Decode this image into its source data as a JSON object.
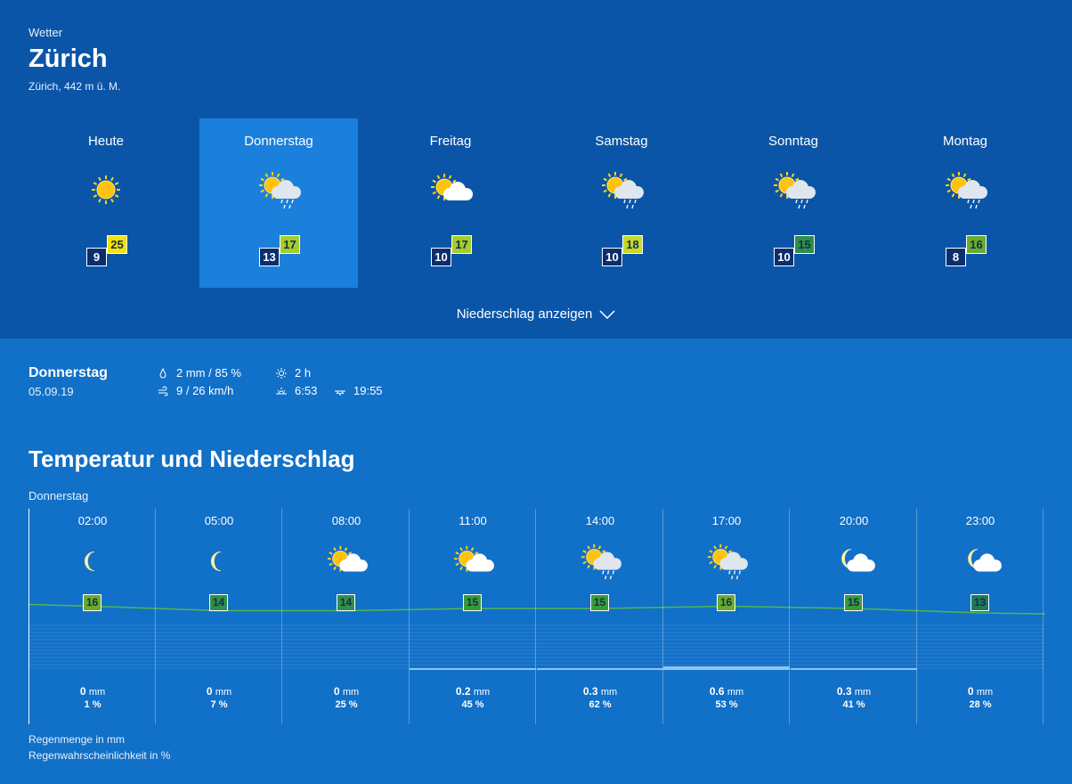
{
  "header": {
    "section_label": "Wetter",
    "city": "Zürich",
    "altitude": "Zürich, 442 m ü. M."
  },
  "days": [
    {
      "name": "Heute",
      "min": "9",
      "max": "25",
      "max_color": "#f5e20a",
      "icon": "sun-icon",
      "selected": false
    },
    {
      "name": "Donnerstag",
      "min": "13",
      "max": "17",
      "max_color": "#a8cc2a",
      "icon": "sun-cloud-rain-icon",
      "selected": true
    },
    {
      "name": "Freitag",
      "min": "10",
      "max": "17",
      "max_color": "#a8cc2a",
      "icon": "sun-cloud-icon",
      "selected": false
    },
    {
      "name": "Samstag",
      "min": "10",
      "max": "18",
      "max_color": "#c7d82a",
      "icon": "sun-cloud-rain-icon",
      "selected": false
    },
    {
      "name": "Sonntag",
      "min": "10",
      "max": "15",
      "max_color": "#2e8f4a",
      "icon": "sun-cloud-rain-icon",
      "selected": false
    },
    {
      "name": "Montag",
      "min": "8",
      "max": "16",
      "max_color": "#6aab2e",
      "icon": "sun-cloud-rain-icon",
      "selected": false
    }
  ],
  "toggle_label": "Niederschlag anzeigen",
  "detail": {
    "day": "Donnerstag",
    "date": "05.09.19",
    "rain": "2 mm / 85 %",
    "wind": "9 / 26 km/h",
    "sunshine": "2 h",
    "sunrise": "6:53",
    "sunset": "19:55"
  },
  "section_title": "Temperatur und Niederschlag",
  "sub_day": "Donnerstag",
  "hours": [
    {
      "time": "02:00",
      "temp": "16",
      "temp_color": "#6aab2e",
      "rain": "0",
      "unit": "mm",
      "prob": "1 %",
      "icon": "moon-icon",
      "rain_mm": 0
    },
    {
      "time": "05:00",
      "temp": "14",
      "temp_color": "#2e8f4a",
      "rain": "0",
      "unit": "mm",
      "prob": "7 %",
      "icon": "moon-icon",
      "rain_mm": 0
    },
    {
      "time": "08:00",
      "temp": "14",
      "temp_color": "#2e8f4a",
      "rain": "0",
      "unit": "mm",
      "prob": "25 %",
      "icon": "sun-cloud-icon",
      "rain_mm": 0
    },
    {
      "time": "11:00",
      "temp": "15",
      "temp_color": "#3a9a3a",
      "rain": "0.2",
      "unit": "mm",
      "prob": "45 %",
      "icon": "sun-cloud-icon",
      "rain_mm": 0.2
    },
    {
      "time": "14:00",
      "temp": "15",
      "temp_color": "#3a9a3a",
      "rain": "0.3",
      "unit": "mm",
      "prob": "62 %",
      "icon": "sun-cloud-rain-icon",
      "rain_mm": 0.3
    },
    {
      "time": "17:00",
      "temp": "16",
      "temp_color": "#6aab2e",
      "rain": "0.6",
      "unit": "mm",
      "prob": "53 %",
      "icon": "sun-cloud-rain-icon",
      "rain_mm": 0.6
    },
    {
      "time": "20:00",
      "temp": "15",
      "temp_color": "#3a9a3a",
      "rain": "0.3",
      "unit": "mm",
      "prob": "41 %",
      "icon": "moon-cloud-icon",
      "rain_mm": 0.3
    },
    {
      "time": "23:00",
      "temp": "13",
      "temp_color": "#1f7a5a",
      "rain": "0",
      "unit": "mm",
      "prob": "28 %",
      "icon": "moon-cloud-icon",
      "rain_mm": 0
    }
  ],
  "legend": {
    "rain_amount": "Regenmenge in mm",
    "rain_prob": "Regenwahrscheinlichkeit in %"
  }
}
